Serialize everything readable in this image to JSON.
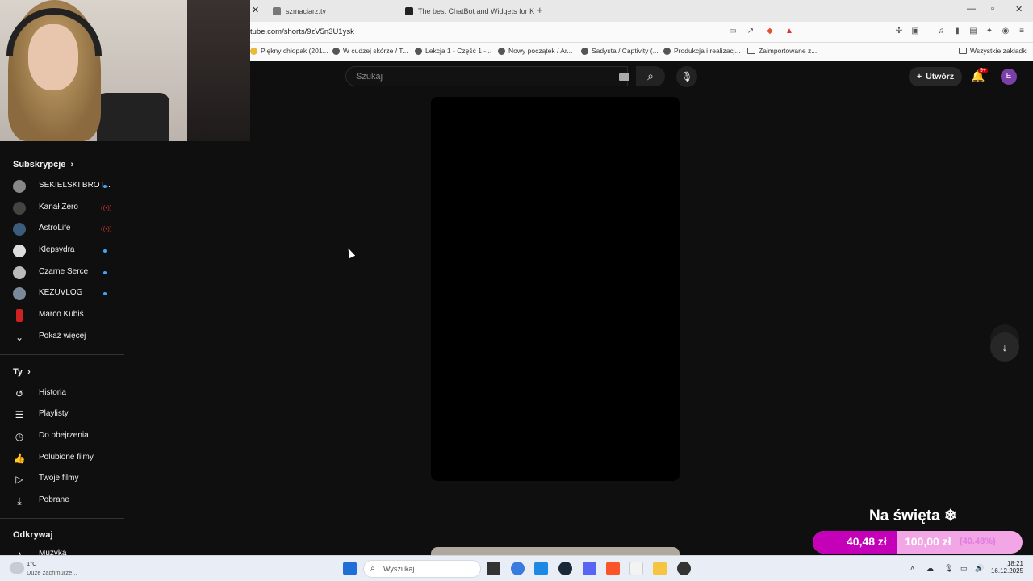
{
  "browser": {
    "tabs": [
      {
        "title": "szmaciarz.tv"
      },
      {
        "title": "The best ChatBot and Widgets for K"
      }
    ],
    "url": "tube.com/shorts/9zV5n3U1ysk",
    "bookmarks": [
      "Piękny chłopak (201...",
      "W cudzej skórze / T...",
      "Lekcja 1 - Część 1 -...",
      "Nowy początek / Ar...",
      "Sadysta / Captivity (...",
      "Produkcja i realizacj...",
      "Zaimportowane z...",
      "Wszystkie zakładki"
    ]
  },
  "youtube": {
    "search_placeholder": "Szukaj",
    "create_label": "Utwórz",
    "notifications_badge": "9+",
    "avatar_letter": "E"
  },
  "sidebar": {
    "subscriptions_title": "Subskrypcje",
    "channels": [
      {
        "name": "SEKIELSKI BROT...",
        "status": "new",
        "color": "#888888"
      },
      {
        "name": "Kanał Zero",
        "status": "live",
        "color": "#444444"
      },
      {
        "name": "AstroLife",
        "status": "live",
        "color": "#3b5c7a"
      },
      {
        "name": "Klepsydra",
        "status": "new",
        "color": "#dddddd"
      },
      {
        "name": "Czarne Serce",
        "status": "new",
        "color": "#bbbbbb"
      },
      {
        "name": "KEZUVLOG",
        "status": "new",
        "color": "#7a8a9a"
      },
      {
        "name": "Marco Kubiś",
        "status": "",
        "color": "#cc2222"
      }
    ],
    "show_more": "Pokaż więcej",
    "you_title": "Ty",
    "you_items": [
      {
        "label": "Historia",
        "icon": "history-icon",
        "glyph": "↺"
      },
      {
        "label": "Playlisty",
        "icon": "playlist-icon",
        "glyph": "☰"
      },
      {
        "label": "Do obejrzenia",
        "icon": "clock-icon",
        "glyph": "◷"
      },
      {
        "label": "Polubione filmy",
        "icon": "thumb-up-icon",
        "glyph": "👍"
      },
      {
        "label": "Twoje filmy",
        "icon": "video-icon",
        "glyph": "▷"
      },
      {
        "label": "Pobrane",
        "icon": "download-icon",
        "glyph": "⤓"
      }
    ],
    "explore_title": "Odkrywaj",
    "explore_items": [
      {
        "label": "Muzyka",
        "icon": "music-icon",
        "glyph": "♪"
      }
    ]
  },
  "donation_goal": {
    "title": "Na święta ❄",
    "current": "40,48 zł",
    "target": "100,00 zł",
    "percent_label": "(40.48%)",
    "fraction": 0.4048
  },
  "taskbar": {
    "temperature": "1°C",
    "weather": "Duże zachmurze...",
    "search_placeholder": "Wyszukaj",
    "time": "18:21",
    "date": "16.12.2025"
  }
}
